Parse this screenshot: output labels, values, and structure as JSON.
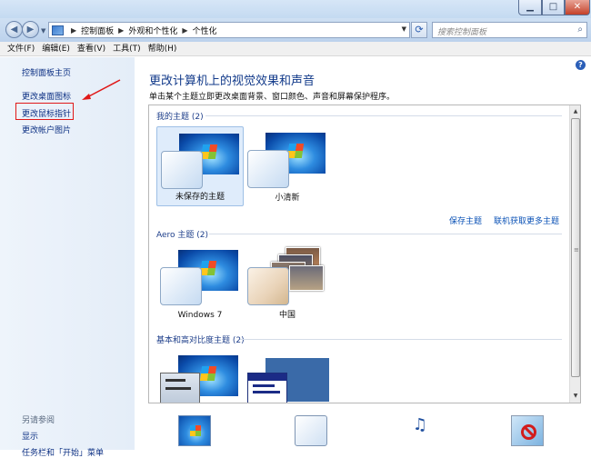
{
  "window": {
    "minimize_glyph": "▁",
    "maximize_glyph": "□",
    "close_glyph": "✕"
  },
  "address": {
    "crumbs": [
      "控制面板",
      "外观和个性化",
      "个性化"
    ],
    "search_placeholder": "搜索控制面板"
  },
  "menu": [
    "文件(F)",
    "编辑(E)",
    "查看(V)",
    "工具(T)",
    "帮助(H)"
  ],
  "sidebar": {
    "home": "控制面板主页",
    "items": [
      "更改桌面图标",
      "更改鼠标指针",
      "更改帐户图片"
    ],
    "see_also": "另请参阅",
    "see_also_items": [
      "显示",
      "任务栏和「开始」菜单"
    ]
  },
  "main": {
    "title": "更改计算机上的视觉效果和声音",
    "description": "单击某个主题立即更改桌面背景、窗口颜色、声音和屏幕保护程序。",
    "groups": [
      {
        "header": "我的主题 (2)",
        "themes": [
          "未保存的主题",
          "小清新"
        ]
      },
      {
        "header": "Aero 主题 (2)",
        "themes": [
          "Windows 7",
          "中国"
        ]
      },
      {
        "header": "基本和高对比度主题 (2)",
        "themes": []
      }
    ],
    "save_theme": "保存主题",
    "get_more": "联机获取更多主题"
  },
  "colors": {
    "link": "#0b2f83",
    "title": "#123a8a",
    "highlight_box": "#e01818",
    "selected_tile": "#dfecfb"
  },
  "icons": [
    "back-arrow-icon",
    "forward-arrow-icon",
    "control-panel-icon",
    "refresh-icon",
    "search-icon",
    "help-icon"
  ]
}
